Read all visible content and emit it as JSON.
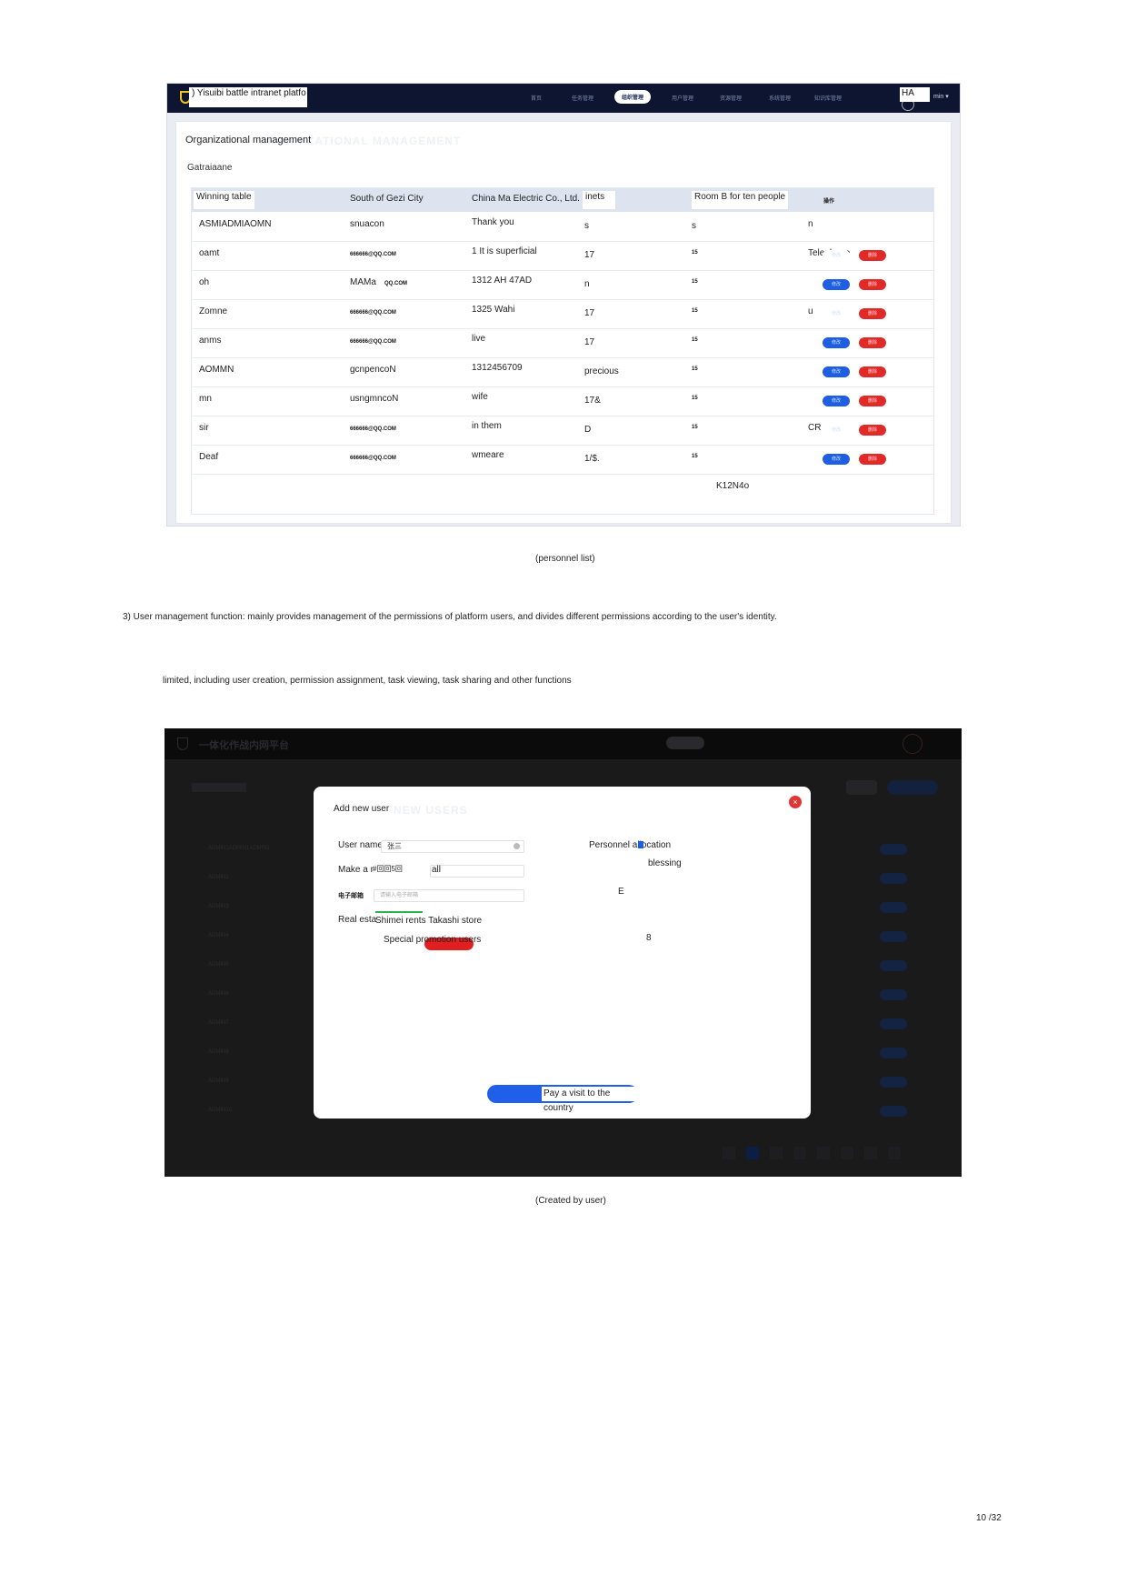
{
  "screenshot1": {
    "brand": ") Yisuibi battle intranet platfo",
    "nav": [
      "首页",
      "任务管理",
      "组织管理",
      "用户管理",
      "资源管理",
      "系统管理",
      "知识库管理"
    ],
    "nav_active_index": 2,
    "user": "HA",
    "user_suffix": "min ▾",
    "panel_title": "Organizational management",
    "panel_ghost": "ORGANIZATIONAL MANAGEMENT",
    "panel_sub": "Gatraiaane",
    "headers": [
      "Winning table",
      "South of Gezi City",
      "China Ma Electric Co., Ltd.",
      "inets",
      "Room B for ten people",
      "操作"
    ],
    "rows": [
      {
        "c1": "ASMIADMIAOMN",
        "c2": "snuacon",
        "c3": "Thank you",
        "c4": "s",
        "c5": "s",
        "c6": "n"
      },
      {
        "c1": "oamt",
        "c2": "666666@QQ.COM",
        "c3": "1 It is superficial",
        "c4": "17",
        "c5": "15",
        "c6": "Telephone"
      },
      {
        "c1": "oh",
        "c2": "MAMa",
        "c2b": "QQ.COM",
        "c3": "1312 AH 47AD",
        "c4": "n",
        "c5": "15",
        "c6": ""
      },
      {
        "c1": "Zomne",
        "c2": "666666@QQ.COM",
        "c3": "1325 Wahi",
        "c4": "17",
        "c5": "15",
        "c6": "u"
      },
      {
        "c1": "anms",
        "c2": "666666@QQ.COM",
        "c3": "live",
        "c4": "17",
        "c5": "15",
        "c6": ""
      },
      {
        "c1": "AOMMN",
        "c2": "gcnpencoN",
        "c3": "1312456709",
        "c4": "precious",
        "c5": "15",
        "c6": ""
      },
      {
        "c1": "mn",
        "c2": "usngmncoN",
        "c3": "wife",
        "c4": "17&",
        "c5": "15",
        "c6": ""
      },
      {
        "c1": "sir",
        "c2": "666666@QQ.COM",
        "c3": "in them",
        "c4": "D",
        "c5": "15",
        "c6": "CR"
      },
      {
        "c1": "Deaf",
        "c2": "666666@QQ.COM",
        "c3": "wmeare",
        "c4": "1/$.",
        "c5": "15",
        "c6": ""
      }
    ],
    "edit_label": "修改",
    "delete_label": "删除",
    "footer_note": "K12N4o"
  },
  "caption1": "(personnel list)",
  "paragraph1": "3) User management function: mainly provides management of the permissions of platform users, and divides different permissions according to the user's identity.",
  "paragraph2": "limited, including user creation, permission assignment, task viewing, task sharing and other functions",
  "screenshot2": {
    "brand": "一体化作战内网平台",
    "modal": {
      "title": "Add new user",
      "title_ghost": "NEW USERS",
      "close": "×",
      "username_label": "User name",
      "username_value": "张三",
      "make_label": "Make a r",
      "make_value": "#回回5回",
      "make_extra": "all",
      "email_label": "电子邮箱",
      "email_placeholder": "请输入电子邮箱",
      "realestate_label": "Real esta",
      "realestate_value": "Shimei rents Takashi store",
      "special_label": "Special promotion users",
      "personnel_label": "Personnel allocation",
      "blessing": "blessing",
      "e_label": "E",
      "eight_label": "8",
      "save_label": "Pay a visit to the country"
    },
    "dim_rows": [
      "ADMIN1ADMIN1ADMIN1",
      "ADMIN2",
      "ADMIN3",
      "ADMIN4",
      "ADMIN5",
      "ADMIN6",
      "ADMIN7",
      "ADMIN8",
      "ADMIN9",
      "ADMIN10"
    ]
  },
  "caption2": "(Created by user)",
  "page_number": "10 /32"
}
